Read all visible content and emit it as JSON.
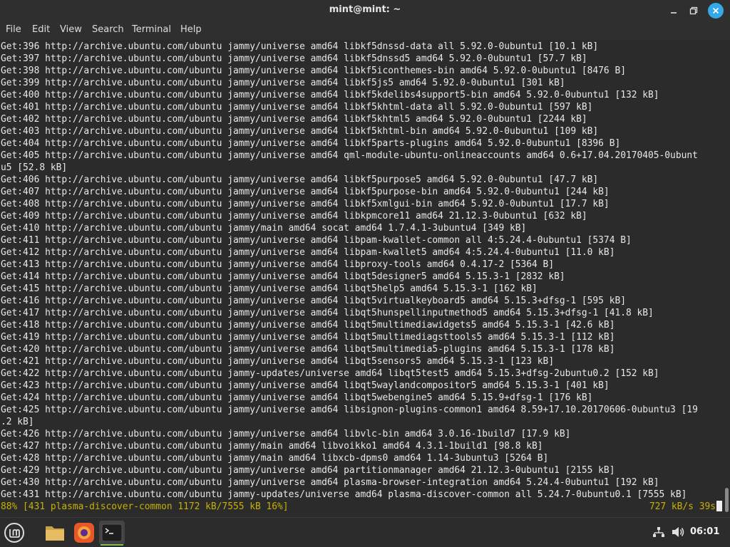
{
  "window": {
    "title": "mint@mint: ~"
  },
  "menu": [
    "File",
    "Edit",
    "View",
    "Search",
    "Terminal",
    "Help"
  ],
  "terminal": {
    "lines": [
      "Get:396 http://archive.ubuntu.com/ubuntu jammy/universe amd64 libkf5dnssd-data all 5.92.0-0ubuntu1 [10.1 kB]",
      "Get:397 http://archive.ubuntu.com/ubuntu jammy/universe amd64 libkf5dnssd5 amd64 5.92.0-0ubuntu1 [57.7 kB]",
      "Get:398 http://archive.ubuntu.com/ubuntu jammy/universe amd64 libkf5iconthemes-bin amd64 5.92.0-0ubuntu1 [8476 B]",
      "Get:399 http://archive.ubuntu.com/ubuntu jammy/universe amd64 libkf5js5 amd64 5.92.0-0ubuntu1 [301 kB]",
      "Get:400 http://archive.ubuntu.com/ubuntu jammy/universe amd64 libkf5kdelibs4support5-bin amd64 5.92.0-0ubuntu1 [132 kB]",
      "Get:401 http://archive.ubuntu.com/ubuntu jammy/universe amd64 libkf5khtml-data all 5.92.0-0ubuntu1 [597 kB]",
      "Get:402 http://archive.ubuntu.com/ubuntu jammy/universe amd64 libkf5khtml5 amd64 5.92.0-0ubuntu1 [2244 kB]",
      "Get:403 http://archive.ubuntu.com/ubuntu jammy/universe amd64 libkf5khtml-bin amd64 5.92.0-0ubuntu1 [109 kB]",
      "Get:404 http://archive.ubuntu.com/ubuntu jammy/universe amd64 libkf5parts-plugins amd64 5.92.0-0ubuntu1 [8396 B]",
      "Get:405 http://archive.ubuntu.com/ubuntu jammy/universe amd64 qml-module-ubuntu-onlineaccounts amd64 0.6+17.04.20170405-0ubunt",
      "u5 [52.8 kB]",
      "Get:406 http://archive.ubuntu.com/ubuntu jammy/universe amd64 libkf5purpose5 amd64 5.92.0-0ubuntu1 [47.7 kB]",
      "Get:407 http://archive.ubuntu.com/ubuntu jammy/universe amd64 libkf5purpose-bin amd64 5.92.0-0ubuntu1 [244 kB]",
      "Get:408 http://archive.ubuntu.com/ubuntu jammy/universe amd64 libkf5xmlgui-bin amd64 5.92.0-0ubuntu1 [17.7 kB]",
      "Get:409 http://archive.ubuntu.com/ubuntu jammy/universe amd64 libkpmcore11 amd64 21.12.3-0ubuntu1 [632 kB]",
      "Get:410 http://archive.ubuntu.com/ubuntu jammy/main amd64 socat amd64 1.7.4.1-3ubuntu4 [349 kB]",
      "Get:411 http://archive.ubuntu.com/ubuntu jammy/universe amd64 libpam-kwallet-common all 4:5.24.4-0ubuntu1 [5374 B]",
      "Get:412 http://archive.ubuntu.com/ubuntu jammy/universe amd64 libpam-kwallet5 amd64 4:5.24.4-0ubuntu1 [11.0 kB]",
      "Get:413 http://archive.ubuntu.com/ubuntu jammy/universe amd64 libproxy-tools amd64 0.4.17-2 [5364 B]",
      "Get:414 http://archive.ubuntu.com/ubuntu jammy/universe amd64 libqt5designer5 amd64 5.15.3-1 [2832 kB]",
      "Get:415 http://archive.ubuntu.com/ubuntu jammy/universe amd64 libqt5help5 amd64 5.15.3-1 [162 kB]",
      "Get:416 http://archive.ubuntu.com/ubuntu jammy/universe amd64 libqt5virtualkeyboard5 amd64 5.15.3+dfsg-1 [595 kB]",
      "Get:417 http://archive.ubuntu.com/ubuntu jammy/universe amd64 libqt5hunspellinputmethod5 amd64 5.15.3+dfsg-1 [41.8 kB]",
      "Get:418 http://archive.ubuntu.com/ubuntu jammy/universe amd64 libqt5multimediawidgets5 amd64 5.15.3-1 [42.6 kB]",
      "Get:419 http://archive.ubuntu.com/ubuntu jammy/universe amd64 libqt5multimediagsttools5 amd64 5.15.3-1 [112 kB]",
      "Get:420 http://archive.ubuntu.com/ubuntu jammy/universe amd64 libqt5multimedia5-plugins amd64 5.15.3-1 [178 kB]",
      "Get:421 http://archive.ubuntu.com/ubuntu jammy/universe amd64 libqt5sensors5 amd64 5.15.3-1 [123 kB]",
      "Get:422 http://archive.ubuntu.com/ubuntu jammy-updates/universe amd64 libqt5test5 amd64 5.15.3+dfsg-2ubuntu0.2 [152 kB]",
      "Get:423 http://archive.ubuntu.com/ubuntu jammy/universe amd64 libqt5waylandcompositor5 amd64 5.15.3-1 [401 kB]",
      "Get:424 http://archive.ubuntu.com/ubuntu jammy/universe amd64 libqt5webengine5 amd64 5.15.9+dfsg-1 [176 kB]",
      "Get:425 http://archive.ubuntu.com/ubuntu jammy/universe amd64 libsignon-plugins-common1 amd64 8.59+17.10.20170606-0ubuntu3 [19",
      ".2 kB]",
      "Get:426 http://archive.ubuntu.com/ubuntu jammy/universe amd64 libvlc-bin amd64 3.0.16-1build7 [17.9 kB]",
      "Get:427 http://archive.ubuntu.com/ubuntu jammy/main amd64 libvoikko1 amd64 4.3.1-1build1 [98.8 kB]",
      "Get:428 http://archive.ubuntu.com/ubuntu jammy/main amd64 libxcb-dpms0 amd64 1.14-3ubuntu3 [5264 B]",
      "Get:429 http://archive.ubuntu.com/ubuntu jammy/universe amd64 partitionmanager amd64 21.12.3-0ubuntu1 [2155 kB]",
      "Get:430 http://archive.ubuntu.com/ubuntu jammy/universe amd64 plasma-browser-integration amd64 5.24.4-0ubuntu1 [192 kB]",
      "Get:431 http://archive.ubuntu.com/ubuntu jammy-updates/universe amd64 plasma-discover-common all 5.24.7-0ubuntu0.1 [7555 kB]"
    ],
    "progress_left": "88% [431 plasma-discover-common 1172 kB/7555 kB 16%]",
    "progress_right": "727 kB/s 39s"
  },
  "taskbar": {
    "clock": "06:01",
    "icons": [
      "mint-menu-icon",
      "files-folder-icon",
      "firefox-icon",
      "terminal-icon"
    ]
  },
  "colors": {
    "close_button": "#35a8e8",
    "progress_text": "#c8b100",
    "active_underline": "#7fbf4f"
  }
}
